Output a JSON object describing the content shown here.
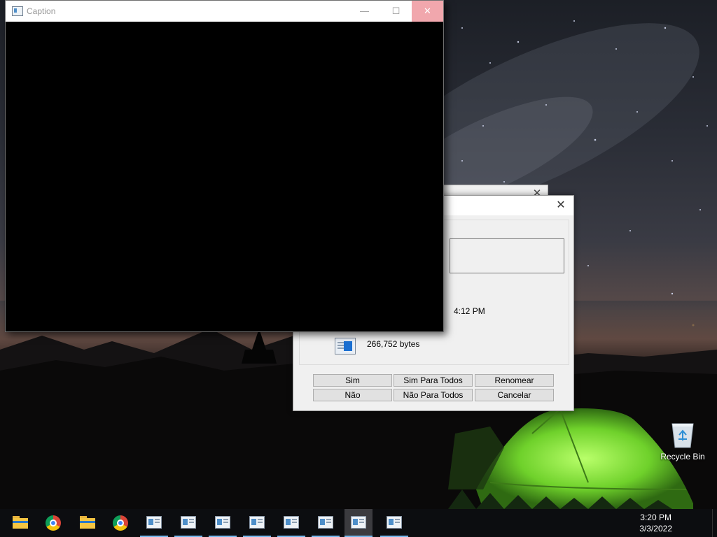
{
  "colors": {
    "dialog_bg": "#f0f0f0",
    "close_hover": "#f1a7ad",
    "taskbar_bg": "#0c0d10",
    "taskbar_underline": "#76b9ed",
    "tent_green": "#7fdc3a"
  },
  "caption_window": {
    "title": "Caption",
    "icon": "app-window-icon",
    "minimize_glyph": "—",
    "maximize_glyph": "☐",
    "close_glyph": "✕"
  },
  "replace_dialog": {
    "close_glyph": "✕",
    "modified_time_text": "4:12 PM",
    "file_size_text": "266,752 bytes",
    "buttons": {
      "yes": "Sim",
      "yes_all": "Sim Para Todos",
      "rename": "Renomear",
      "no": "Não",
      "no_all": "Não Para Todos",
      "cancel": "Cancelar"
    }
  },
  "back_dialog": {
    "close_glyph": "✕"
  },
  "desktop": {
    "recycle_bin_label": "Recycle Bin"
  },
  "taskbar": {
    "items": [
      {
        "icon": "file-explorer-icon"
      },
      {
        "icon": "chrome-icon"
      },
      {
        "icon": "file-explorer-icon"
      },
      {
        "icon": "chrome-icon"
      },
      {
        "icon": "app-window-icon"
      },
      {
        "icon": "app-window-icon"
      },
      {
        "icon": "app-window-icon"
      },
      {
        "icon": "app-window-icon"
      },
      {
        "icon": "app-window-icon"
      },
      {
        "icon": "app-window-icon"
      },
      {
        "icon": "app-window-icon",
        "active": true
      },
      {
        "icon": "app-window-icon"
      }
    ],
    "clock_time": "3:20 PM",
    "clock_date": "3/3/2022"
  }
}
